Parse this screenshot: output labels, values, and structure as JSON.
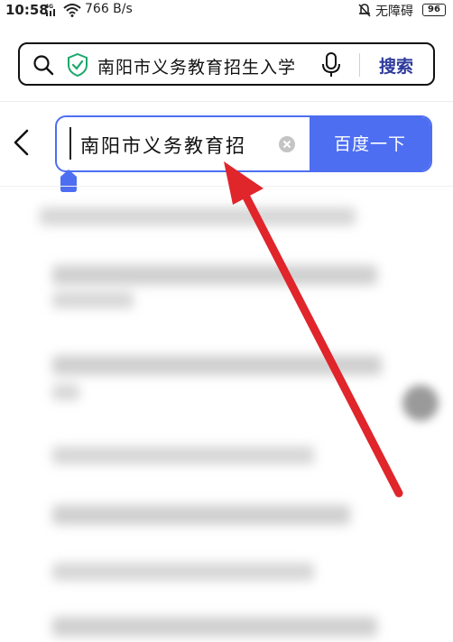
{
  "status_bar": {
    "time": "10:58",
    "network_label": "4G",
    "net_speed": "766 B/s",
    "no_barrier": "无障碍",
    "battery": "96"
  },
  "top_search": {
    "query": "南阳市义务教育招生入学",
    "search_label": "搜索"
  },
  "baidu": {
    "input_value": "南阳市义务教育招",
    "button_label": "百度一下"
  },
  "colors": {
    "accent_blue": "#4e6ef2",
    "arrow_red": "#e0252b",
    "search_label_blue": "#2d3a9c"
  }
}
